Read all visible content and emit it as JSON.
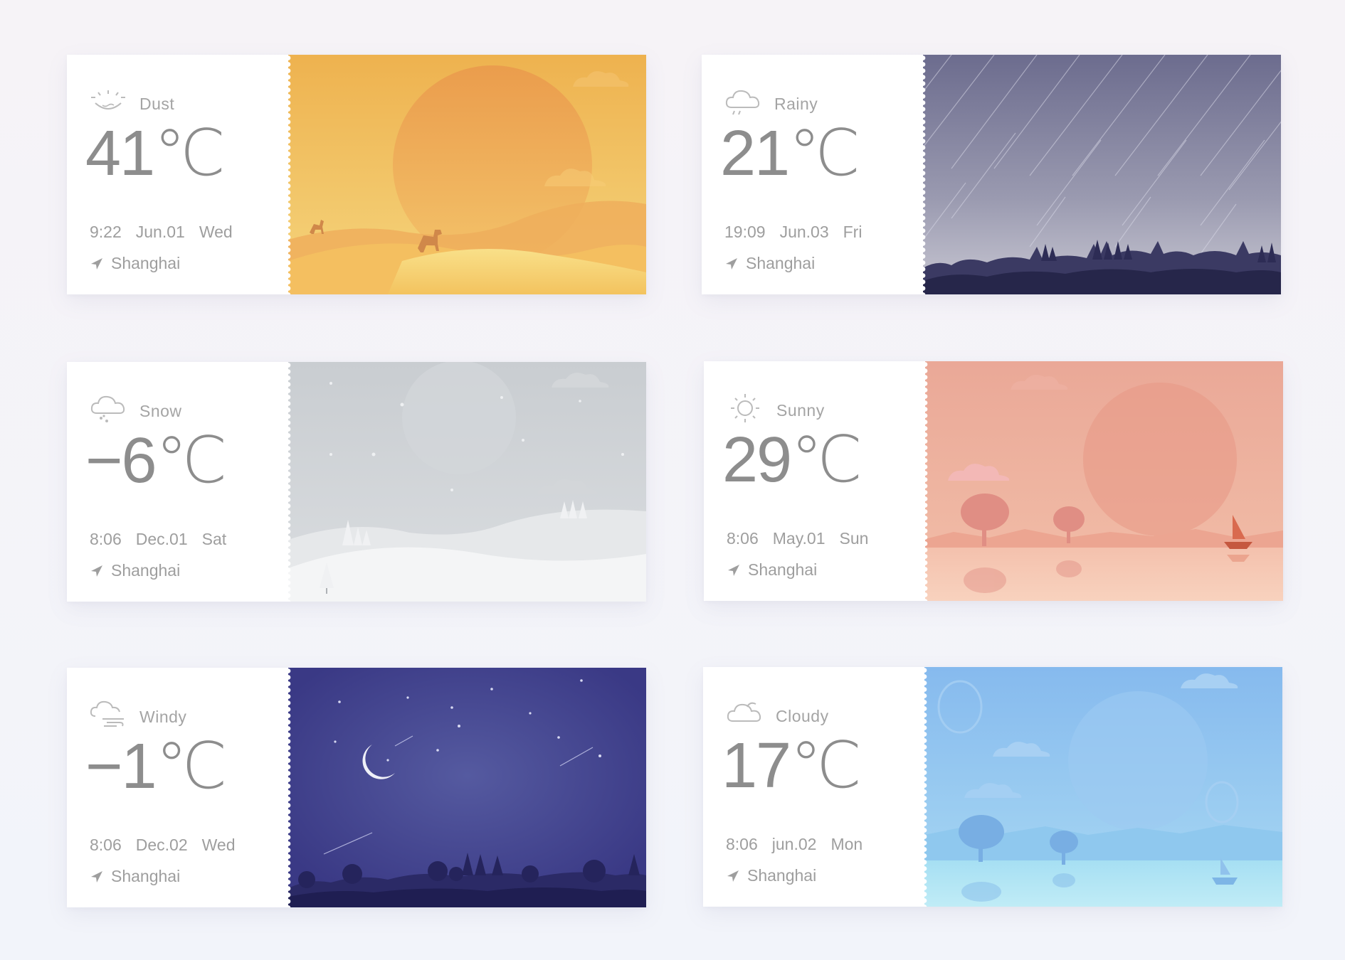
{
  "cards": [
    {
      "condition": "Dust",
      "temp": "41℃",
      "time": "9:22",
      "date": "Jun.01",
      "day": "Wed",
      "city": "Shanghai",
      "icon": "dust-icon",
      "accent": "#f0b24a"
    },
    {
      "condition": "Rainy",
      "temp": "21℃",
      "time": "19:09",
      "date": "Jun.03",
      "day": "Fri",
      "city": "Shanghai",
      "icon": "rain-cloud-icon",
      "accent": "#6e6e90"
    },
    {
      "condition": "Snow",
      "temp": "−6℃",
      "time": "8:06",
      "date": "Dec.01",
      "day": "Sat",
      "city": "Shanghai",
      "icon": "snow-cloud-icon",
      "accent": "#d2d6da"
    },
    {
      "condition": "Sunny",
      "temp": "29℃",
      "time": "8:06",
      "date": "May.01",
      "day": "Sun",
      "city": "Shanghai",
      "icon": "sun-icon",
      "accent": "#eba99a"
    },
    {
      "condition": "Windy",
      "temp": "−1℃",
      "time": "8:06",
      "date": "Dec.02",
      "day": "Wed",
      "city": "Shanghai",
      "icon": "wind-cloud-icon",
      "accent": "#3e3d8a"
    },
    {
      "condition": "Cloudy",
      "temp": "17℃",
      "time": "8:06",
      "date": "jun.02",
      "day": "Mon",
      "city": "Shanghai",
      "icon": "cloud-icon",
      "accent": "#8cc0f0"
    }
  ]
}
